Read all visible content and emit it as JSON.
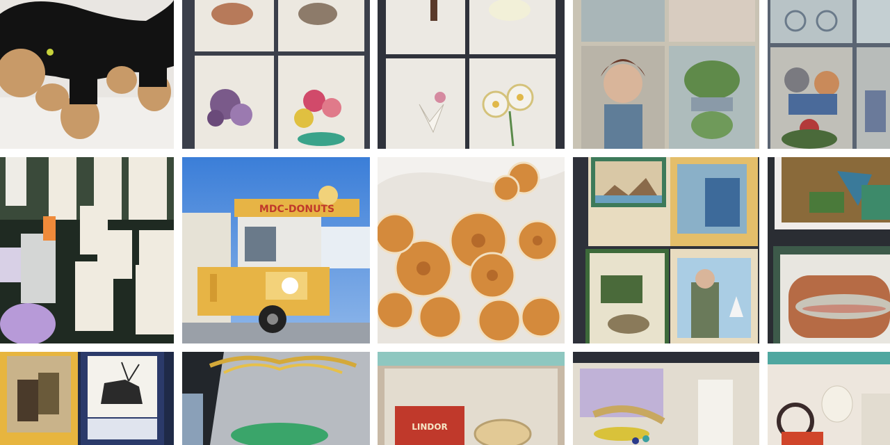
{
  "gallery": {
    "tiles": [
      {
        "icon": "knitted-dog-icon",
        "colors": {
          "bg": "#e9e6e2",
          "main": "#121212",
          "accent": "#c89a68"
        }
      },
      {
        "icon": "floral-card-icon",
        "colors": {
          "bg": "#3b3f4a",
          "card": "#ece8e0"
        }
      },
      {
        "icon": "floral-card-icon",
        "colors": {
          "bg": "#2f323b",
          "card": "#ece9e3"
        }
      },
      {
        "icon": "vintage-card-icon",
        "colors": {
          "bg": "#c9c3b4",
          "card": "#a9b6b8"
        }
      },
      {
        "icon": "kitten-card-icon",
        "colors": {
          "bg": "#5a6472",
          "card": "#b8c3c6"
        }
      },
      {
        "icon": "gift-box-icon",
        "colors": {
          "bg": "#1f2a22",
          "box": "#f0ebe0"
        }
      },
      {
        "icon": "donut-truck-icon",
        "colors": {
          "sky": "#3b7ed8",
          "truck": "#e7b445"
        },
        "sign_text": "MDC-DONUTS"
      },
      {
        "icon": "mini-donut-icon",
        "colors": {
          "bg": "#d6d2cc",
          "donut": "#d48a3c"
        }
      },
      {
        "icon": "outdoor-card-icon",
        "colors": {
          "bg": "#2e313a",
          "card": "#e8dcc0"
        }
      },
      {
        "icon": "fish-card-icon",
        "colors": {
          "bg": "#2a2d33",
          "card": "#b66b45"
        }
      },
      {
        "icon": "deer-card-icon",
        "colors": {
          "bg": "#1f2a48",
          "card": "#e7b53f"
        }
      },
      {
        "icon": "gift-basket-icon",
        "colors": {
          "bg": "#22262b",
          "wrap": "#c8ccd2"
        }
      },
      {
        "icon": "treat-box-icon",
        "colors": {
          "bg": "#c8b9a6",
          "box": "#e3dccf"
        },
        "label_text": "LINDOR"
      },
      {
        "icon": "gift-crate-icon",
        "colors": {
          "bg": "#3a3f58",
          "box": "#e2dcd0"
        }
      },
      {
        "icon": "gift-crate-icon",
        "colors": {
          "bg": "#3b3542",
          "box": "#ede6dd"
        }
      }
    ]
  }
}
